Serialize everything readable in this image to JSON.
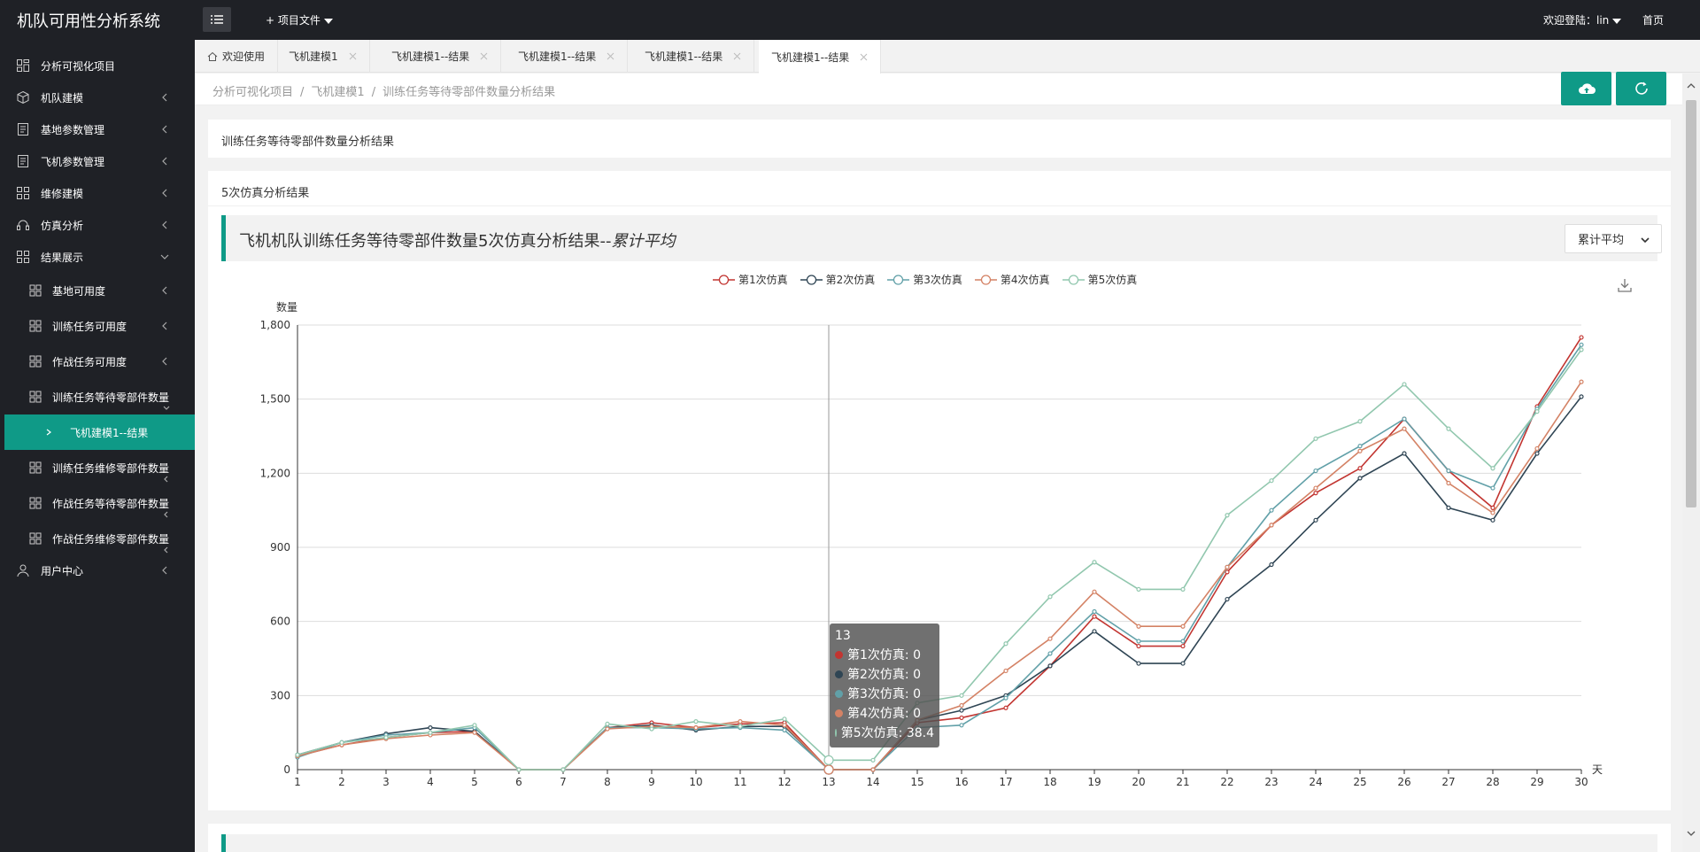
{
  "app": {
    "title": "机队可用性分析系统"
  },
  "topbar": {
    "project_menu": "+ 项目文件",
    "user_welcome": "欢迎登陆：lin",
    "home": "首页"
  },
  "sidebar": {
    "items": [
      {
        "label": "分析可视化项目",
        "icon": "dashboard-icon"
      },
      {
        "label": "机队建模",
        "icon": "cube-icon"
      },
      {
        "label": "基地参数管理",
        "icon": "document-icon"
      },
      {
        "label": "飞机参数管理",
        "icon": "document-icon"
      },
      {
        "label": "维修建模",
        "icon": "grid-icon"
      },
      {
        "label": "仿真分析",
        "icon": "headset-icon"
      },
      {
        "label": "结果展示",
        "icon": "grid-icon"
      },
      {
        "label": "基地可用度",
        "icon": "grid-icon"
      },
      {
        "label": "训练任务可用度",
        "icon": "grid-icon"
      },
      {
        "label": "作战任务可用度",
        "icon": "grid-icon"
      },
      {
        "label": "训练任务等待零部件数量",
        "icon": "grid-icon"
      },
      {
        "label": "飞机建模1--结果",
        "icon": "chevron-right-icon"
      },
      {
        "label": "训练任务维修零部件数量",
        "icon": "grid-icon"
      },
      {
        "label": "作战任务等待零部件数量",
        "icon": "grid-icon"
      },
      {
        "label": "作战任务维修零部件数量",
        "icon": "grid-icon"
      },
      {
        "label": "用户中心",
        "icon": "user-icon"
      }
    ]
  },
  "tabs": [
    {
      "label": "欢迎使用"
    },
    {
      "label": "飞机建模1"
    },
    {
      "label": "飞机建模1--结果"
    },
    {
      "label": "飞机建模1--结果"
    },
    {
      "label": "飞机建模1--结果"
    },
    {
      "label": "飞机建模1--结果"
    }
  ],
  "breadcrumb": [
    "分析可视化项目",
    "飞机建模1",
    "训练任务等待零部件数量分析结果"
  ],
  "page": {
    "section_title": "训练任务等待零部件数量分析结果",
    "panel_title": "5次仿真分析结果",
    "chart_heading": "飞机机队训练任务等待零部件数量5次仿真分析结果--",
    "chart_heading_em": "累计平均",
    "agg_select": "累计平均"
  },
  "colors": {
    "accent": "#0f9a87",
    "dark": "#1f2126"
  },
  "chart_data": {
    "type": "line",
    "ylabel": "数量",
    "xlabel": "天",
    "x": [
      1,
      2,
      3,
      4,
      5,
      6,
      7,
      8,
      9,
      10,
      11,
      12,
      13,
      14,
      15,
      16,
      17,
      18,
      19,
      20,
      21,
      22,
      23,
      24,
      25,
      26,
      27,
      28,
      29,
      30
    ],
    "ylim": [
      0,
      1800
    ],
    "yticks": [
      0,
      300,
      600,
      900,
      1200,
      1500,
      1800
    ],
    "ytick_labels": [
      "0",
      "300",
      "600",
      "900",
      "1,200",
      "1,500",
      "1,800"
    ],
    "grid": true,
    "legend_position": "top-center",
    "series": [
      {
        "name": "第1次仿真",
        "color": "#c23531",
        "values": [
          55,
          100,
          130,
          150,
          155,
          0,
          0,
          170,
          190,
          170,
          185,
          190,
          0,
          0,
          190,
          210,
          250,
          420,
          620,
          500,
          500,
          800,
          990,
          1120,
          1220,
          1420,
          1210,
          1060,
          1470,
          1750
        ]
      },
      {
        "name": "第2次仿真",
        "color": "#2f4554",
        "values": [
          60,
          110,
          145,
          170,
          155,
          0,
          0,
          170,
          180,
          160,
          175,
          175,
          0,
          0,
          200,
          240,
          300,
          420,
          560,
          430,
          430,
          690,
          830,
          1010,
          1180,
          1280,
          1060,
          1010,
          1280,
          1510
        ]
      },
      {
        "name": "第3次仿真",
        "color": "#61a0a8",
        "values": [
          50,
          110,
          140,
          150,
          170,
          0,
          0,
          170,
          170,
          165,
          170,
          160,
          0,
          0,
          170,
          180,
          290,
          470,
          640,
          520,
          520,
          820,
          1050,
          1210,
          1310,
          1420,
          1210,
          1140,
          1460,
          1720
        ]
      },
      {
        "name": "第4次仿真",
        "color": "#d48265",
        "values": [
          55,
          100,
          125,
          140,
          150,
          0,
          0,
          165,
          175,
          170,
          195,
          180,
          0,
          0,
          200,
          260,
          400,
          530,
          720,
          580,
          580,
          820,
          990,
          1140,
          1290,
          1380,
          1160,
          1040,
          1300,
          1570
        ]
      },
      {
        "name": "第5次仿真",
        "color": "#91c7ae",
        "values": [
          60,
          110,
          130,
          150,
          180,
          0,
          0,
          185,
          165,
          195,
          175,
          205,
          38.4,
          38.4,
          270,
          300,
          510,
          700,
          840,
          730,
          730,
          1030,
          1170,
          1340,
          1410,
          1560,
          1380,
          1220,
          1450,
          1700
        ]
      }
    ],
    "tooltip": {
      "x": "13",
      "rows": [
        "第1次仿真: 0",
        "第2次仿真: 0",
        "第3次仿真: 0",
        "第4次仿真: 0",
        "第5次仿真: 38.4"
      ]
    }
  }
}
